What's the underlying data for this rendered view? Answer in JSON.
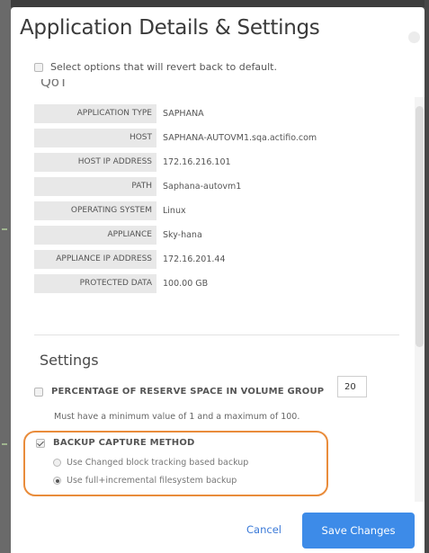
{
  "dialog": {
    "title": "Application Details & Settings",
    "revert_label": "Select options that will revert back to default.",
    "partial_section_heading": "QoT"
  },
  "details": [
    {
      "key": "APPLICATION TYPE",
      "value": "SAPHANA"
    },
    {
      "key": "HOST",
      "value": "SAPHANA-AUTOVM1.sqa.actifio.com"
    },
    {
      "key": "HOST IP ADDRESS",
      "value": "172.16.216.101"
    },
    {
      "key": "PATH",
      "value": "Saphana-autovm1"
    },
    {
      "key": "OPERATING SYSTEM",
      "value": "Linux"
    },
    {
      "key": "APPLIANCE",
      "value": "Sky-hana"
    },
    {
      "key": "APPLIANCE IP ADDRESS",
      "value": "172.16.201.44"
    },
    {
      "key": "PROTECTED DATA",
      "value": "100.00 GB"
    }
  ],
  "settings": {
    "heading": "Settings",
    "reserve_label": "PERCENTAGE OF RESERVE SPACE IN VOLUME GROUP",
    "reserve_value": "20",
    "reserve_hint": "Must have a minimum value of 1 and a maximum of 100.",
    "capture_label": "BACKUP CAPTURE METHOD",
    "capture_options": [
      {
        "label": "Use Changed block tracking based backup",
        "selected": false
      },
      {
        "label": "Use full+incremental filesystem backup",
        "selected": true
      }
    ]
  },
  "footer": {
    "cancel_label": "Cancel",
    "save_label": "Save Changes"
  },
  "colors": {
    "primary": "#3d8be8",
    "highlight": "#e98c3b"
  }
}
